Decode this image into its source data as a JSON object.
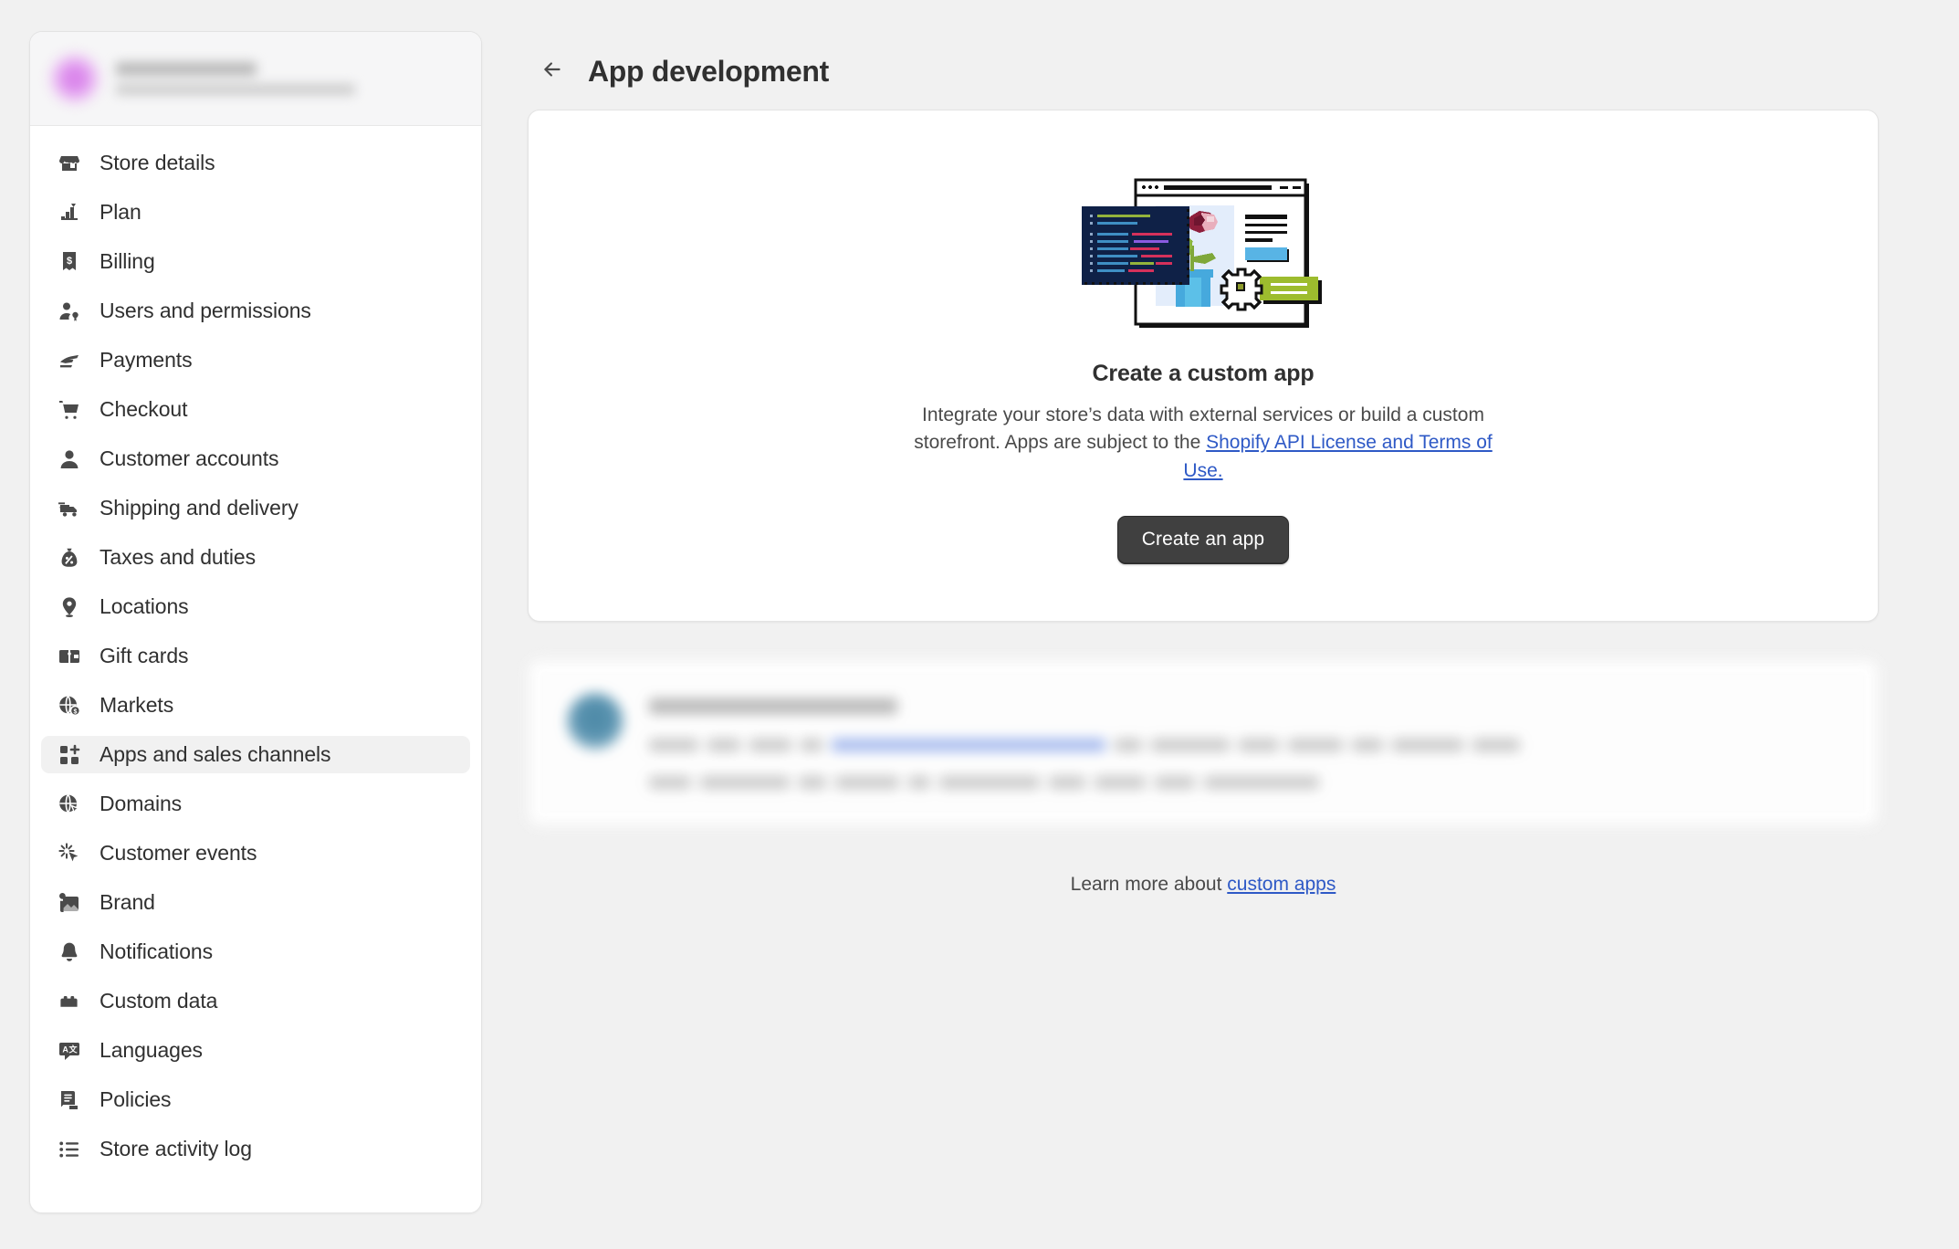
{
  "sidebar": {
    "store": {
      "name_redacted": true,
      "avatar_color": "#d879e8"
    },
    "items": [
      {
        "label": "Store details",
        "icon": "storefront-icon",
        "active": false
      },
      {
        "label": "Plan",
        "icon": "plan-chart-icon",
        "active": false
      },
      {
        "label": "Billing",
        "icon": "billing-receipt-icon",
        "active": false
      },
      {
        "label": "Users and permissions",
        "icon": "users-permissions-icon",
        "active": false
      },
      {
        "label": "Payments",
        "icon": "payments-icon",
        "active": false
      },
      {
        "label": "Checkout",
        "icon": "cart-icon",
        "active": false
      },
      {
        "label": "Customer accounts",
        "icon": "person-icon",
        "active": false
      },
      {
        "label": "Shipping and delivery",
        "icon": "delivery-truck-icon",
        "active": false
      },
      {
        "label": "Taxes and duties",
        "icon": "taxes-bag-icon",
        "active": false
      },
      {
        "label": "Locations",
        "icon": "location-pin-icon",
        "active": false
      },
      {
        "label": "Gift cards",
        "icon": "gift-card-icon",
        "active": false
      },
      {
        "label": "Markets",
        "icon": "globe-dollar-icon",
        "active": false
      },
      {
        "label": "Apps and sales channels",
        "icon": "apps-grid-plus-icon",
        "active": true
      },
      {
        "label": "Domains",
        "icon": "globe-cursor-icon",
        "active": false
      },
      {
        "label": "Customer events",
        "icon": "click-sparkle-icon",
        "active": false
      },
      {
        "label": "Brand",
        "icon": "brand-image-icon",
        "active": false
      },
      {
        "label": "Notifications",
        "icon": "bell-icon",
        "active": false
      },
      {
        "label": "Custom data",
        "icon": "custom-data-block-icon",
        "active": false
      },
      {
        "label": "Languages",
        "icon": "languages-icon",
        "active": false
      },
      {
        "label": "Policies",
        "icon": "policies-document-icon",
        "active": false
      },
      {
        "label": "Store activity log",
        "icon": "activity-list-icon",
        "active": false
      }
    ]
  },
  "header": {
    "title": "App development",
    "back_icon": "arrow-left-icon"
  },
  "card": {
    "illustration": "custom-app-illustration",
    "title": "Create a custom app",
    "body_part1": "Integrate your store’s data with external services or build a custom storefront. Apps are subject to the ",
    "body_link": "Shopify API License and Terms of Use.",
    "cta_label": "Create an app"
  },
  "footer": {
    "prefix": "Learn more about ",
    "link": "custom apps"
  },
  "colors": {
    "page_bg": "#f1f1f1",
    "surface": "#ffffff",
    "text": "#303030",
    "subdued_text": "#4a4a4a",
    "link": "#2e59c6",
    "active_nav_bg": "#f1f1f1",
    "primary_button_bg": "#404040"
  }
}
